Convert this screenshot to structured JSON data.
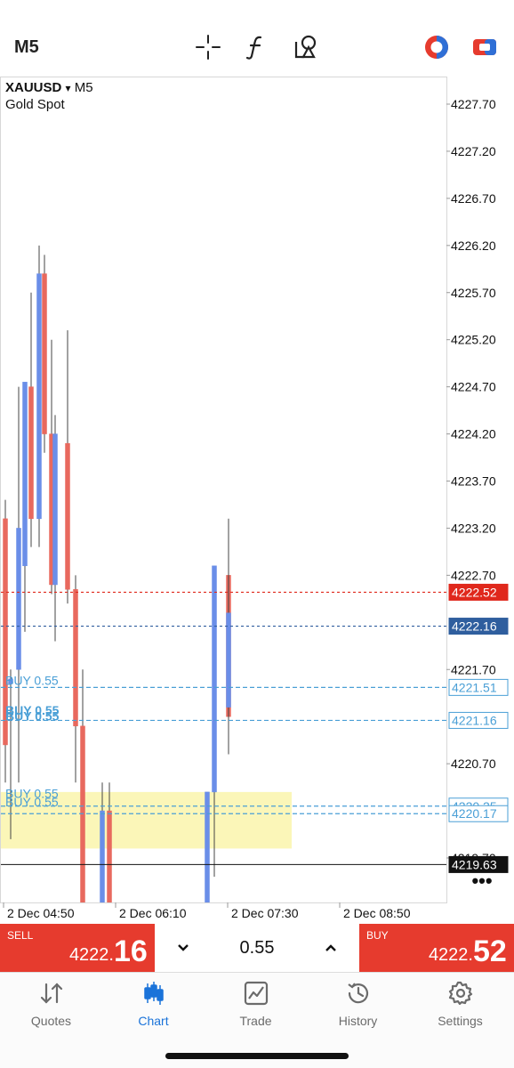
{
  "toolbar": {
    "timeframe": "M5",
    "icons": [
      "crosshair-icon",
      "indicators-icon",
      "objects-icon",
      "trade-mode-icon",
      "one-click-trading-icon"
    ]
  },
  "chart_header": {
    "symbol": "XAUUSD",
    "dropdown": "▾",
    "timeframe": "M5",
    "description": "Gold Spot"
  },
  "chart_data": {
    "type": "candlestick",
    "ylim": [
      4219.4,
      4228.0
    ],
    "y_ticks": [
      "4227.70",
      "4227.20",
      "4226.70",
      "4226.20",
      "4225.70",
      "4225.20",
      "4224.70",
      "4224.20",
      "4223.70",
      "4223.20",
      "4222.70",
      "4221.70",
      "4220.70",
      "4219.70"
    ],
    "x_ticks": [
      "2 Dec 04:50",
      "2 Dec 06:10",
      "2 Dec 07:30",
      "2 Dec 08:50"
    ],
    "candles": [
      {
        "o": 4223.3,
        "h": 4223.5,
        "l": 4220.5,
        "c": 4220.9,
        "dir": "down"
      },
      {
        "o": 4221.55,
        "h": 4221.7,
        "l": 4219.9,
        "c": 4221.6,
        "dir": "up"
      },
      {
        "o": 4221.7,
        "h": 4224.7,
        "l": 4220.5,
        "c": 4223.2,
        "dir": "up"
      },
      {
        "o": 4222.8,
        "h": 4224.7,
        "l": 4222.1,
        "c": 4224.75,
        "dir": "up"
      },
      {
        "o": 4224.7,
        "h": 4225.7,
        "l": 4223.0,
        "c": 4223.3,
        "dir": "down"
      },
      {
        "o": 4223.3,
        "h": 4226.2,
        "l": 4223.0,
        "c": 4225.9,
        "dir": "up"
      },
      {
        "o": 4225.9,
        "h": 4226.1,
        "l": 4224.0,
        "c": 4224.2,
        "dir": "down"
      },
      {
        "o": 4224.2,
        "h": 4225.2,
        "l": 4222.5,
        "c": 4222.6,
        "dir": "down"
      },
      {
        "o": 4222.6,
        "h": 4224.4,
        "l": 4222.0,
        "c": 4224.2,
        "dir": "up"
      },
      {
        "o": 4224.1,
        "h": 4225.3,
        "l": 4222.4,
        "c": 4222.55,
        "dir": "down"
      },
      {
        "o": 4222.55,
        "h": 4222.7,
        "l": 4220.5,
        "c": 4221.1,
        "dir": "down"
      },
      {
        "o": 4221.1,
        "h": 4221.7,
        "l": 4218.5,
        "c": 4218.8,
        "dir": "down"
      },
      {
        "o": 4218.8,
        "h": 4220.5,
        "l": 4218.6,
        "c": 4220.2,
        "dir": "up"
      },
      {
        "o": 4220.2,
        "h": 4220.5,
        "l": 4218.6,
        "c": 4218.9,
        "dir": "down"
      },
      {
        "o": 4219.0,
        "h": 4220.4,
        "l": 4218.8,
        "c": 4220.4,
        "dir": "up"
      },
      {
        "o": 4220.4,
        "h": 4222.8,
        "l": 4219.5,
        "c": 4222.8,
        "dir": "up"
      },
      {
        "o": 4222.7,
        "h": 4223.3,
        "l": 4221.1,
        "c": 4221.2,
        "dir": "down"
      },
      {
        "o": 4221.3,
        "h": 4223.3,
        "l": 4220.8,
        "c": 4222.3,
        "dir": "up"
      }
    ],
    "price_lines": [
      {
        "label": "4222.52",
        "value": 4222.52,
        "kind": "ask",
        "color": "#e0281c"
      },
      {
        "label": "4222.16",
        "value": 4222.16,
        "kind": "bid",
        "color": "#2f5e9e"
      },
      {
        "label": "4221.51",
        "value": 4221.51,
        "kind": "order",
        "color": "#4a9fd6"
      },
      {
        "label": "4221.16",
        "value": 4221.16,
        "kind": "order",
        "color": "#4a9fd6"
      },
      {
        "label": "4220.25",
        "value": 4220.25,
        "kind": "order",
        "color": "#4a9fd6"
      },
      {
        "label": "4220.17",
        "value": 4220.17,
        "kind": "order",
        "color": "#4a9fd6"
      },
      {
        "label": "4219.63",
        "value": 4219.63,
        "kind": "last",
        "color": "#111111"
      }
    ],
    "order_labels": [
      {
        "text": "BUY 0.55",
        "value": 4221.51,
        "bold": false
      },
      {
        "text": "BUY 0.55",
        "value": 4221.19,
        "bold": true
      },
      {
        "text": "BUY 0.55",
        "value": 4221.13,
        "bold": true
      },
      {
        "text": "BUY 0.55",
        "value": 4220.31,
        "bold": false
      },
      {
        "text": "BUY 0.55",
        "value": 4220.22,
        "bold": false
      }
    ],
    "zone": {
      "from": 4219.8,
      "to": 4220.4,
      "color": "#fbf6b8"
    },
    "colors": {
      "up": "#6a8ee8",
      "down": "#e8695e",
      "wick": "#444444",
      "order": "#4a9fd6"
    }
  },
  "trade": {
    "sell_label": "SELL",
    "sell_price_prefix": "4222.",
    "sell_price_big": "16",
    "buy_label": "BUY",
    "buy_price_prefix": "4222.",
    "buy_price_big": "52",
    "volume": "0.55",
    "down_glyph": "⌄",
    "up_glyph": "⌃"
  },
  "tabs": [
    {
      "label": "Quotes",
      "icon": "quotes-icon",
      "active": false
    },
    {
      "label": "Chart",
      "icon": "chart-icon",
      "active": true
    },
    {
      "label": "Trade",
      "icon": "trade-icon",
      "active": false
    },
    {
      "label": "History",
      "icon": "history-icon",
      "active": false
    },
    {
      "label": "Settings",
      "icon": "settings-icon",
      "active": false
    }
  ],
  "colors": {
    "sell": "#e63b2e",
    "buy": "#e63b2e",
    "accent": "#1a73d9"
  }
}
